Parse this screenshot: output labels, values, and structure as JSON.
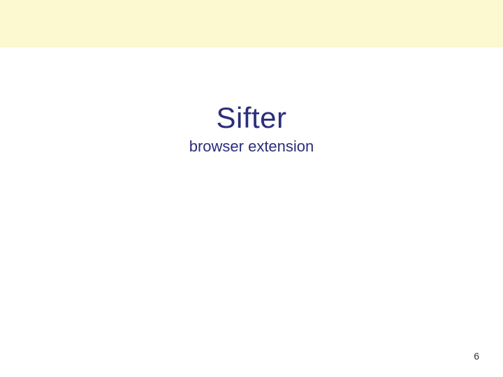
{
  "slide": {
    "title": "Sifter",
    "subtitle": "browser extension",
    "page_number": "6"
  }
}
